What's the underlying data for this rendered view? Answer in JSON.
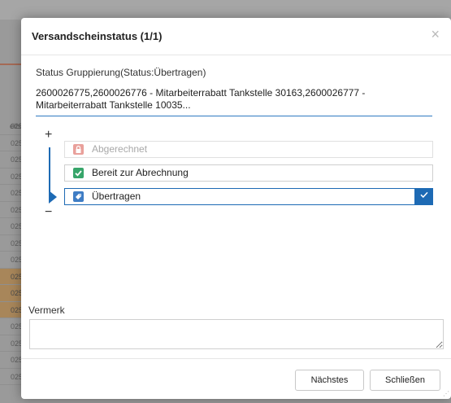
{
  "background": {
    "side_header": "eits",
    "rows": [
      "025",
      "025",
      "025",
      "025",
      "025",
      "025",
      "025",
      "025",
      "025",
      "025",
      "025",
      "025",
      "025",
      "025",
      "025",
      "025"
    ]
  },
  "dialog": {
    "title": "Versandscheinstatus (1/1)",
    "close_symbol": "×",
    "group_label": "Status Gruppierung(Status:Übertragen)",
    "group_value": "2600026775,2600026776 - Mitarbeiterrabatt Tankstelle 30163,2600026777 - Mitarbeiterrabatt Tankstelle 10035...",
    "tree": {
      "expand_symbol": "+",
      "collapse_symbol": "−",
      "statuses": [
        {
          "label": "Abgerechnet",
          "icon": "lock-icon",
          "state": "disabled"
        },
        {
          "label": "Bereit zur Abrechnung",
          "icon": "checkmark-icon",
          "state": "normal"
        },
        {
          "label": "Übertragen",
          "icon": "tag-icon",
          "state": "selected"
        }
      ]
    },
    "remark": {
      "label": "Vermerk",
      "value": ""
    },
    "buttons": {
      "next": "Nächstes",
      "close": "Schließen"
    }
  },
  "colors": {
    "accent": "#1d6ab4",
    "disabled_icon": "#e9a09b",
    "ready_icon": "#37a56a"
  }
}
